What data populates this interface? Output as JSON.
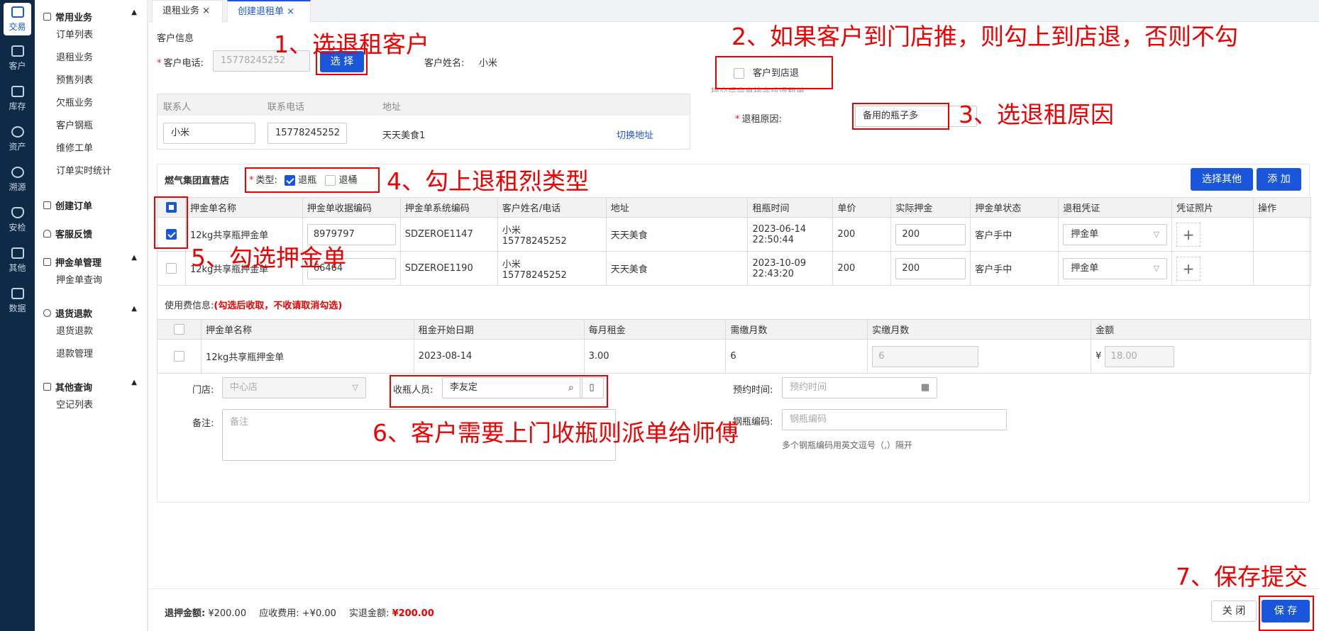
{
  "rail": [
    {
      "label": "交易",
      "icon": "trade-icon",
      "active": true
    },
    {
      "label": "客户",
      "icon": "customer-icon"
    },
    {
      "label": "库存",
      "icon": "inventory-icon"
    },
    {
      "label": "资产",
      "icon": "asset-icon"
    },
    {
      "label": "溯源",
      "icon": "trace-icon"
    },
    {
      "label": "安检",
      "icon": "safety-icon"
    },
    {
      "label": "其他",
      "icon": "other-icon"
    },
    {
      "label": "数据",
      "icon": "data-icon"
    }
  ],
  "menu": {
    "common": {
      "title": "常用业务",
      "items": [
        "订单列表",
        "退租业务",
        "预售列表",
        "欠瓶业务",
        "客户钢瓶",
        "维修工单",
        "订单实时统计"
      ]
    },
    "create_order": "创建订单",
    "feedback": "客服反馈",
    "deposit": {
      "title": "押金单管理",
      "items": [
        "押金单查询"
      ]
    },
    "refund": {
      "title": "退货退款",
      "items": [
        "退货退款",
        "退款管理"
      ]
    },
    "other": {
      "title": "其他查询",
      "items": [
        "空记列表"
      ]
    }
  },
  "tabs": [
    {
      "label": "退租业务",
      "close": "×"
    },
    {
      "label": "创建退租单",
      "close": "×"
    }
  ],
  "customer": {
    "section_title": "客户信息",
    "phone_label": "客户电话:",
    "phone_value": "15778245252",
    "select_btn": "选 择",
    "name_label": "客户姓名:",
    "name_value": "小米",
    "store_return_label": "客户到店退",
    "store_return_hint": "提交后会直接完成退租单",
    "reason_label": "退租原因:",
    "reason_value": "备用的瓶子多",
    "contact_headers": [
      "联系人",
      "联系电话",
      "地址"
    ],
    "contact_name": "小米",
    "contact_phone": "15778245252",
    "address": "天天美食1",
    "switch_address": "切换地址"
  },
  "deposit": {
    "store": "燃气集团直营店",
    "type_label": "类型:",
    "type_bottle": "退瓶",
    "type_bucket": "退桶",
    "select_other_btn": "选择其他",
    "add_btn": "添 加",
    "headers": [
      "押金单名称",
      "押金单收据编码",
      "押金单系统编码",
      "客户姓名/电话",
      "地址",
      "租瓶时间",
      "单价",
      "实际押金",
      "押金单状态",
      "退租凭证",
      "凭证照片",
      "操作"
    ],
    "rows": [
      {
        "checked": true,
        "name": "12kg共享瓶押金单",
        "receipt": "8979797",
        "sys": "SDZEROE1147",
        "cust_name": "小米",
        "cust_phone": "15778245252",
        "address": "天天美食",
        "date": "2023-06-14",
        "time": "22:50:44",
        "price": "200",
        "actual": "200",
        "status": "客户手中",
        "voucher": "押金单",
        "plus": "+"
      },
      {
        "checked": false,
        "name": "12kg共享瓶押金单",
        "receipt": "66464",
        "sys": "SDZEROE1190",
        "cust_name": "小米",
        "cust_phone": "15778245252",
        "address": "天天美食",
        "date": "2023-10-09",
        "time": "22:43:20",
        "price": "200",
        "actual": "200",
        "status": "客户手中",
        "voucher": "押金单",
        "plus": "+"
      }
    ]
  },
  "usage": {
    "label": "使用费信息:",
    "hint": "(勾选后收取，不收请取消勾选)",
    "headers": [
      "押金单名称",
      "租金开始日期",
      "每月租金",
      "需缴月数",
      "实缴月数",
      "金额"
    ],
    "row": {
      "name": "12kg共享瓶押金单",
      "start": "2023-08-14",
      "monthly": "3.00",
      "months": "6",
      "paid_months": "6",
      "currency": "¥",
      "amount": "18.00"
    }
  },
  "form": {
    "store_label": "门店:",
    "store_value": "中心店",
    "collector_label": "收瓶人员:",
    "collector_value": "李友定",
    "appoint_label": "预约时间:",
    "appoint_placeholder": "预约时间",
    "remark_label": "备注:",
    "remark_placeholder": "备注",
    "code_label": "钢瓶编码:",
    "code_placeholder": "钢瓶编码",
    "code_hint": "多个钢瓶编码用英文逗号（,）隔开"
  },
  "footer": {
    "refund_label": "退押金额:",
    "refund_value": "¥200.00",
    "due_label": "应收费用:",
    "due_value": "+¥0.00",
    "actual_label": "实退金额:",
    "actual_value": "¥200.00",
    "close_btn": "关 闭",
    "save_btn": "保 存"
  },
  "annotations": {
    "a1": "1、选退租客户",
    "a2": "2、如果客户到门店推，则勾上到店退，否则不勾",
    "a3": "3、选退租原因",
    "a4": "4、勾上退租烈类型",
    "a5": "5、勾选押金单",
    "a6": "6、客户需要上门收瓶则派单给师傅",
    "a7": "7、保存提交"
  },
  "colors": {
    "primary": "#1a56db",
    "annotation": "#e00000",
    "rail": "#0e2a47"
  }
}
